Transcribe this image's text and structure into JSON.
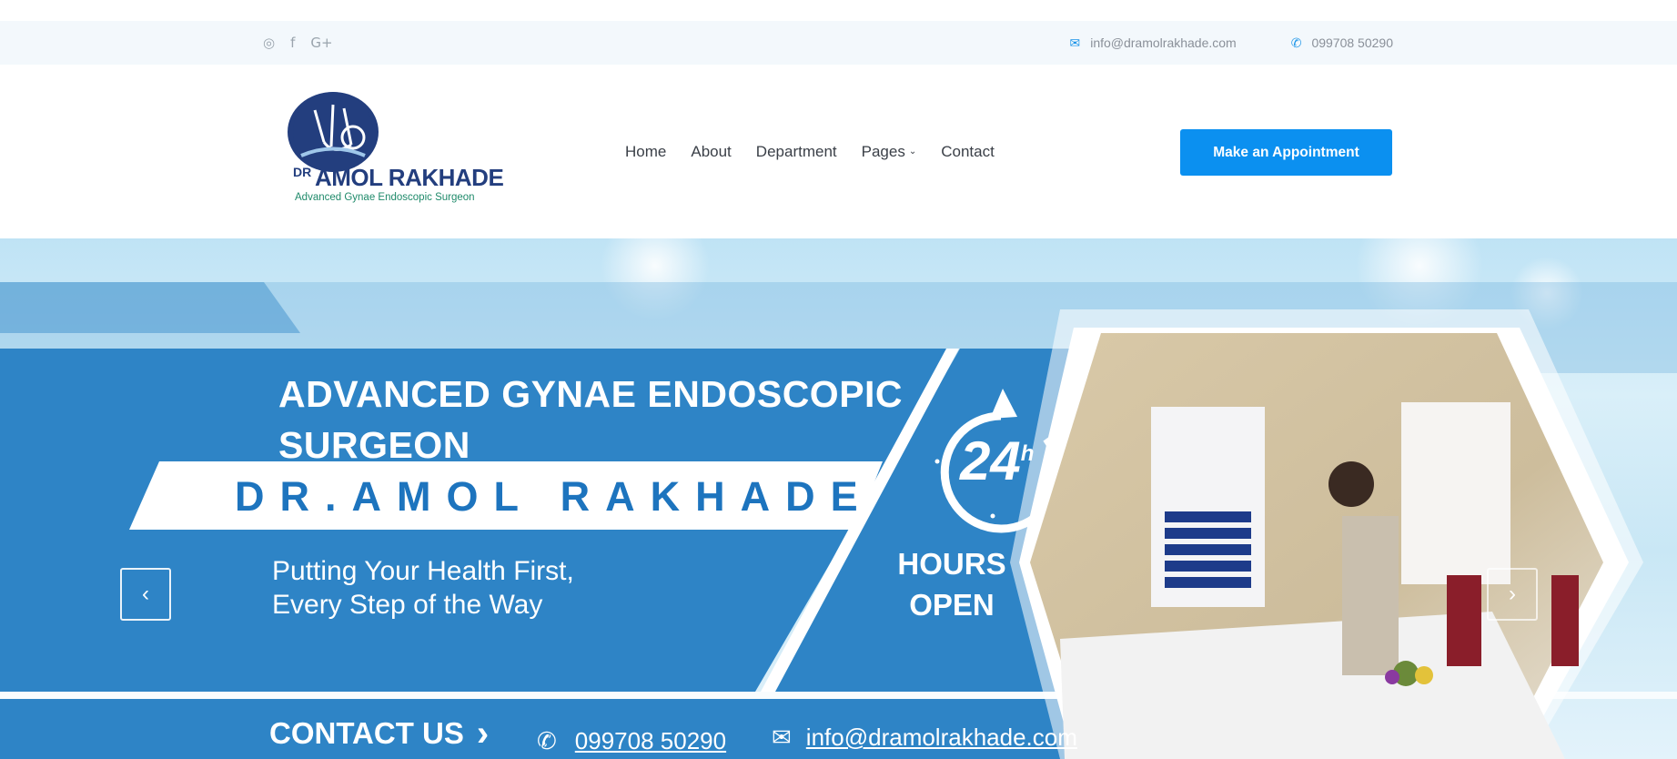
{
  "topbar": {
    "social": [
      {
        "icon": "instagram-icon",
        "glyph": "◎"
      },
      {
        "icon": "facebook-icon",
        "glyph": "f"
      },
      {
        "icon": "google-plus-icon",
        "glyph": "G+"
      }
    ],
    "email": "info@dramolrakhade.com",
    "phone": "099708 50290"
  },
  "logo": {
    "dr": "DR",
    "name": "AMOL RAKHADE",
    "subtitle": "Advanced Gynae Endoscopic Surgeon"
  },
  "nav": {
    "home": "Home",
    "about": "About",
    "department": "Department",
    "pages": "Pages",
    "contact": "Contact"
  },
  "cta_label": "Make an Appointment",
  "hero": {
    "title_line1": "ADVANCED GYNAE ENDOSCOPIC",
    "title_line2": "SURGEON",
    "doctor_name": "DR.AMOL RAKHADE",
    "tagline_line1": "Putting Your Health First,",
    "tagline_line2": "Every Step of the Way",
    "badge_number": "24",
    "badge_sup": "h",
    "hours_line1": "HOURS",
    "hours_line2": "OPEN",
    "contact_label": "CONTACT US",
    "phone": "099708 50290",
    "email": "info@dramolrakhade.com"
  },
  "colors": {
    "primary_blue": "#0b90f0",
    "banner_blue": "#2e84c6",
    "logo_navy": "#233e7e"
  }
}
